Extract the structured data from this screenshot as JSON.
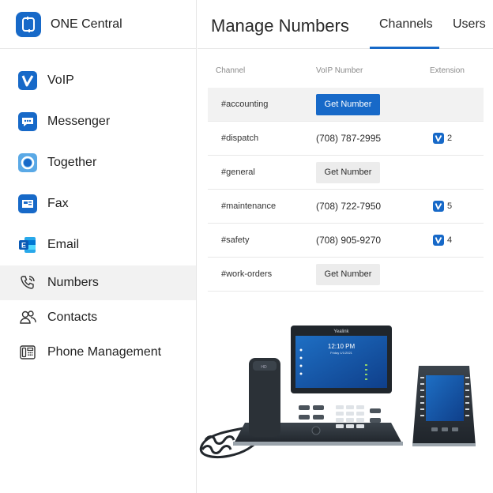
{
  "brand": {
    "title": "ONE Central"
  },
  "nav": [
    {
      "label": "VoIP",
      "icon": "voip-v-icon"
    },
    {
      "label": "Messenger",
      "icon": "chat-bubble-icon"
    },
    {
      "label": "Together",
      "icon": "circle-meeting-icon"
    },
    {
      "label": "Fax",
      "icon": "fax-icon"
    },
    {
      "label": "Email",
      "icon": "exchange-email-icon"
    },
    {
      "label": "Numbers",
      "icon": "phone-number-icon"
    },
    {
      "label": "Contacts",
      "icon": "people-icon"
    },
    {
      "label": "Phone Management",
      "icon": "desk-phone-icon"
    }
  ],
  "active_nav": "Numbers",
  "header": {
    "title": "Manage Numbers",
    "tabs": [
      "Channels",
      "Users"
    ],
    "active_tab": "Channels"
  },
  "table": {
    "columns": [
      "Channel",
      "VoIP Number",
      "Extension"
    ],
    "rows": [
      {
        "channel": "#accounting",
        "voip": "",
        "button": "Get Number",
        "extension": ""
      },
      {
        "channel": "#dispatch",
        "voip": "(708) 787-2995",
        "button": "",
        "extension": "2"
      },
      {
        "channel": "#general",
        "voip": "",
        "button": "Get Number",
        "extension": ""
      },
      {
        "channel": "#maintenance",
        "voip": "(708) 722-7950",
        "button": "",
        "extension": "5"
      },
      {
        "channel": "#safety",
        "voip": "(708) 905-9270",
        "button": "",
        "extension": "4"
      },
      {
        "channel": "#work-orders",
        "voip": "",
        "button": "Get Number",
        "extension": ""
      }
    ]
  },
  "phone": {
    "brand": "Yealink",
    "time": "12:10 PM",
    "date": "Friday 1/1/2021"
  },
  "colors": {
    "accent": "#1769c8",
    "row_highlight": "#f2f2f2",
    "button_secondary": "#ececec"
  }
}
